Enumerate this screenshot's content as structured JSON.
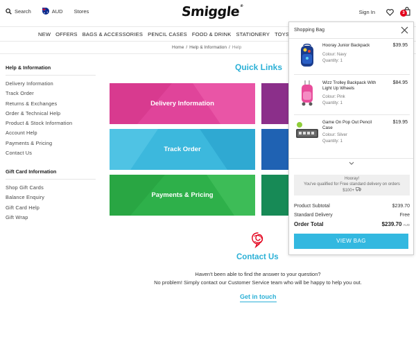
{
  "header": {
    "search_label": "Search",
    "currency_label": "AUD",
    "stores_label": "Stores",
    "logo_text": "Smiggle",
    "signin_label": "Sign In",
    "bag_count": "3"
  },
  "nav": {
    "items": [
      "NEW",
      "OFFERS",
      "BAGS & ACCESSORIES",
      "PENCIL CASES",
      "FOOD & DRINK",
      "STATIONERY",
      "TOYS & CR"
    ]
  },
  "breadcrumb": {
    "items": [
      "Home",
      "Help & Information",
      "Help"
    ]
  },
  "sidebar": {
    "help_title": "Help & Information",
    "help_links": [
      "Delivery Information",
      "Track Order",
      "Returns & Exchanges",
      "Order & Technical Help",
      "Product & Stock Information",
      "Account Help",
      "Payments & Pricing",
      "Contact Us"
    ],
    "gift_title": "Gift Card Information",
    "gift_links": [
      "Shop Gift Cards",
      "Balance Enquiry",
      "Gift Card Help",
      "Gift Wrap"
    ]
  },
  "main": {
    "quick_links_title": "Quick Links",
    "tiles": [
      "Delivery Information",
      "Track Order",
      "Payments & Pricing"
    ],
    "contact_title": "Contact Us",
    "contact_line1": "Haven't been able to find the answer to your question?",
    "contact_line2": "No problem! Simply contact our Customer Service team who will be happy to help you out.",
    "get_in_touch": "Get in touch"
  },
  "bag_panel": {
    "title": "Shopping Bag",
    "items": [
      {
        "name": "Hooray Junior Backpack",
        "price": "$39.95",
        "colour": "Colour: Navy",
        "quantity": "Quantity: 1"
      },
      {
        "name": "Wizz Trolley Backpack With Light Up Wheels",
        "price": "$84.95",
        "colour": "Colour: Pink",
        "quantity": "Quantity: 1"
      },
      {
        "name": "Game On Pop Out Pencil Case",
        "price": "$19.95",
        "colour": "Colour: Silver",
        "quantity": "Quantity: 1"
      }
    ],
    "promo_line1": "Hooray!",
    "promo_line2": "You've qualified for Free standard delivery on orders",
    "promo_line3": "$100+",
    "subtotal_label": "Product Subtotal",
    "subtotal_value": "$239.70",
    "delivery_label": "Standard Delivery",
    "delivery_value": "Free",
    "total_label": "Order Total",
    "total_value": "$239.70",
    "total_currency": "AUD",
    "view_bag_label": "VIEW BAG"
  },
  "colors": {
    "accent": "#2bb0d6",
    "view_bag": "#33b8e0",
    "badge": "#e3001b",
    "tile_delivery": "#e0449a",
    "tile_track": "#3cb8dd",
    "tile_payments": "#2eb04a"
  }
}
